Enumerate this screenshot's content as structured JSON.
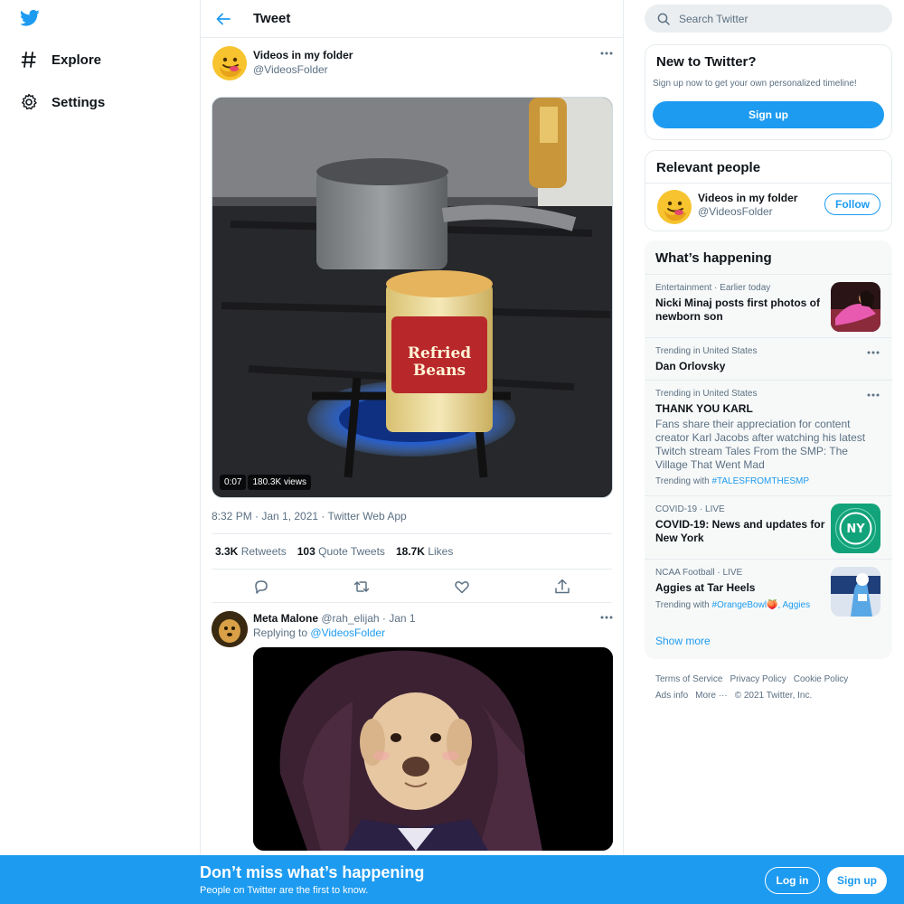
{
  "nav": {
    "explore_label": "Explore",
    "settings_label": "Settings"
  },
  "header": {
    "title": "Tweet"
  },
  "tweet": {
    "author_name": "Videos in my folder",
    "author_handle": "@VideosFolder",
    "video_duration": "0:07",
    "video_views": "180.3K views",
    "can_text_line1": "Refried",
    "can_text_line2": "Beans",
    "timestamp": "8:32 PM · Jan 1, 2021 · Twitter Web App",
    "retweets_count": "3.3K",
    "retweets_label": "Retweets",
    "quotes_count": "103",
    "quotes_label": "Quote Tweets",
    "likes_count": "18.7K",
    "likes_label": "Likes"
  },
  "reply": {
    "name": "Meta Malone",
    "handle": "@rah_elijah",
    "date": "· Jan 1",
    "replying_prefix": "Replying to",
    "replying_to": "@VideosFolder"
  },
  "search": {
    "placeholder": "Search Twitter"
  },
  "new_to_twitter": {
    "title": "New to Twitter?",
    "subtitle": "Sign up now to get your own personalized timeline!",
    "signup_label": "Sign up"
  },
  "relevant_people": {
    "title": "Relevant people",
    "name": "Videos in my folder",
    "handle": "@VideosFolder",
    "follow_label": "Follow"
  },
  "whats_happening": {
    "title": "What’s happening",
    "trends": [
      {
        "category": "Entertainment · Earlier today",
        "title": "Nicki Minaj posts first photos of newborn son"
      },
      {
        "category": "Trending in United States",
        "title": "Dan Orlovsky"
      },
      {
        "category": "Trending in United States",
        "title": "THANK YOU KARL",
        "description": "Fans share their appreciation for content creator Karl Jacobs after watching his latest Twitch stream Tales From the SMP: The Village That Went Mad",
        "with_prefix": "Trending with",
        "with_tag": "#TALESFROMTHESMP"
      },
      {
        "category": "COVID-19 · LIVE",
        "title": "COVID-19: News and updates for New York",
        "thumb_text": "NY"
      },
      {
        "category": "NCAA Football · LIVE",
        "title": "Aggies at Tar Heels",
        "with_prefix": "Trending with",
        "with_tag": "#OrangeBowl🍑",
        "with_tag2": ", Aggies"
      }
    ],
    "show_more": "Show more"
  },
  "footer": {
    "links": [
      "Terms of Service",
      "Privacy Policy",
      "Cookie Policy",
      "Ads info",
      "More ···",
      "© 2021 Twitter, Inc."
    ]
  },
  "bottom_bar": {
    "title": "Don’t miss what’s happening",
    "subtitle": "People on Twitter are the first to know.",
    "login_label": "Log in",
    "signup_label": "Sign up"
  },
  "colors": {
    "accent": "#1d9bf0",
    "text": "#0f1419",
    "secondary": "#5b7083",
    "border": "#e6ecf0"
  },
  "icons": [
    "twitter-logo-icon",
    "hashtag-icon",
    "gear-icon",
    "back-arrow-icon",
    "search-icon",
    "more-icon",
    "reply-icon",
    "retweet-icon",
    "like-icon",
    "share-icon"
  ]
}
